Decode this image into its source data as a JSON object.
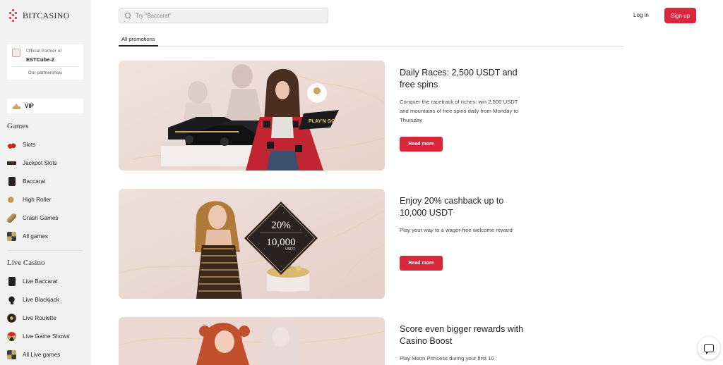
{
  "brand": {
    "name": "BITCASINO"
  },
  "partner": {
    "caption": "Official Partner of",
    "name": "ESTCube-2",
    "link": "Our partnerships"
  },
  "vip": {
    "label": "VIP"
  },
  "games": {
    "title": "Games",
    "items": [
      {
        "label": "Slots",
        "icon": "cherries-icon"
      },
      {
        "label": "Jackpot Slots",
        "icon": "jackpot-icon"
      },
      {
        "label": "Baccarat",
        "icon": "cards-icon"
      },
      {
        "label": "High Roller",
        "icon": "chips-icon"
      },
      {
        "label": "Crash Games",
        "icon": "rocket-icon"
      },
      {
        "label": "All games",
        "icon": "grid-icon"
      }
    ]
  },
  "live_casino": {
    "title": "Live Casino",
    "items": [
      {
        "label": "Live Baccarat",
        "icon": "live-cards-icon"
      },
      {
        "label": "Live Blackjack",
        "icon": "spade-icon"
      },
      {
        "label": "Live Roulette",
        "icon": "roulette-icon"
      },
      {
        "label": "Live Game Shows",
        "icon": "game-show-icon"
      },
      {
        "label": "All Live games",
        "icon": "grid-icon"
      }
    ]
  },
  "search": {
    "placeholder": "Try \"Baccarat\""
  },
  "header": {
    "login": "Log in",
    "signup": "Sign up"
  },
  "tabs": [
    {
      "label": "All promotions",
      "active": true
    }
  ],
  "promotions": [
    {
      "title": "Daily Races: 2,500 USDT and free spins",
      "description": "Conquer the racetrack of riches: win 2,500 USDT and mountains of free spins daily from Monday to Thursday",
      "button": "Read more",
      "image_text": "PLAY'N GO"
    },
    {
      "title": "Enjoy 20% cashback up to 10,000 USDT",
      "description": "Play your way to a wager-free welcome reward",
      "button": "Read more",
      "image_text": {
        "percent": "20%",
        "amount": "10,000",
        "unit": "USDT"
      }
    },
    {
      "title": "Score even bigger rewards with Casino Boost",
      "description": "Play Moon Princess during your first 10"
    }
  ],
  "colors": {
    "accent": "#d8263b",
    "sidebar_bg": "#f2f2f2",
    "banner_bg": "#ecd9d4"
  }
}
